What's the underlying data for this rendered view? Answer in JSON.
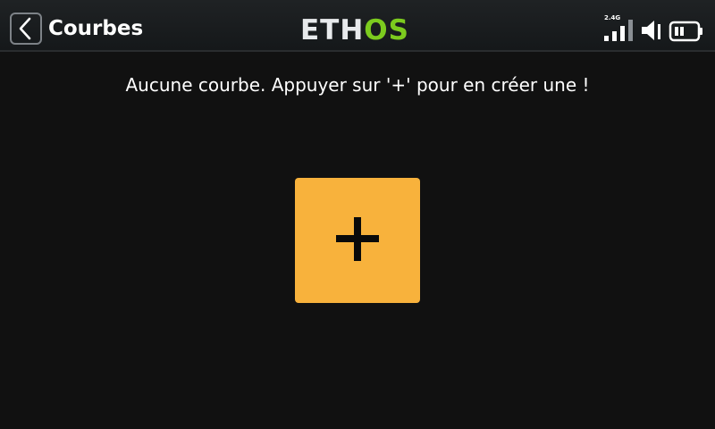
{
  "header": {
    "title": "Courbes",
    "brand": {
      "prefix": "ETH",
      "suffix": "OS"
    },
    "status": {
      "radio_band": "2.4G",
      "signal_bars": 4,
      "signal_bars_active": 3
    }
  },
  "main": {
    "empty_message": "Aucune courbe. Appuyer sur '+' pour en créer une !",
    "add_button_label": "+"
  },
  "colors": {
    "background": "#111111",
    "accent": "#f8b23c",
    "brand_green": "#7ccb1e",
    "text": "#ffffff"
  },
  "icons": {
    "back": "chevron-left-icon",
    "signal": "signal-bars-icon",
    "volume": "speaker-icon",
    "battery": "battery-icon",
    "add": "plus-icon"
  }
}
